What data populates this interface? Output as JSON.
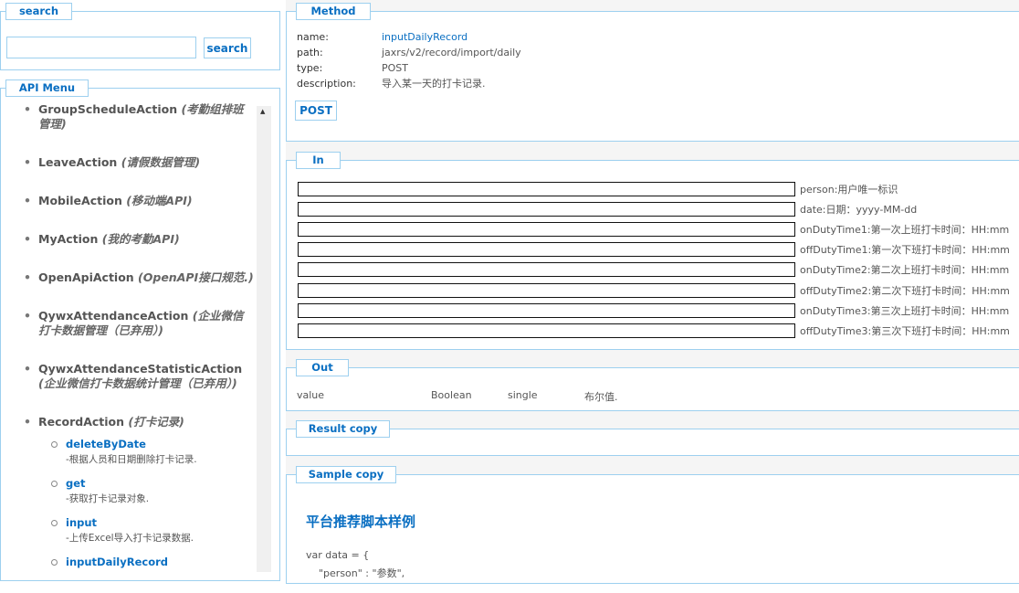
{
  "search": {
    "legend": "search",
    "placeholder": "",
    "button": "search"
  },
  "menu": {
    "legend": "API Menu",
    "items": [
      {
        "name": "GroupScheduleAction",
        "desc": "(考勤组排班管理)"
      },
      {
        "name": "LeaveAction",
        "desc": "(请假数据管理)"
      },
      {
        "name": "MobileAction",
        "desc": "(移动端API)"
      },
      {
        "name": "MyAction",
        "desc": "(我的考勤API)"
      },
      {
        "name": "OpenApiAction",
        "desc": "(OpenAPI接口规范.)"
      },
      {
        "name": "QywxAttendanceAction",
        "desc": "(企业微信打卡数据管理（已弃用）)"
      },
      {
        "name": "QywxAttendanceStatisticAction",
        "desc": "(企业微信打卡数据统计管理（已弃用）)"
      },
      {
        "name": "RecordAction",
        "desc": "(打卡记录)",
        "subs": [
          {
            "name": "deleteByDate",
            "desc": "-根据人员和日期删除打卡记录."
          },
          {
            "name": "get",
            "desc": "-获取打卡记录对象."
          },
          {
            "name": "input",
            "desc": "-上传Excel导入打卡记录数据."
          },
          {
            "name": "inputDailyRecord",
            "desc": ""
          }
        ]
      }
    ]
  },
  "method": {
    "legend": "Method",
    "name_label": "name:",
    "name": "inputDailyRecord",
    "path_label": "path:",
    "path": "jaxrs/v2/record/import/daily",
    "type_label": "type:",
    "type": "POST",
    "desc_label": "description:",
    "description": "导入某一天的打卡记录.",
    "button": "POST"
  },
  "in": {
    "legend": "In",
    "fields": [
      "person:用户唯一标识",
      "date:日期：yyyy-MM-dd",
      "onDutyTime1:第一次上班打卡时间：HH:mm",
      "offDutyTime1:第一次下班打卡时间：HH:mm",
      "onDutyTime2:第二次上班打卡时间：HH:mm",
      "offDutyTime2:第二次下班打卡时间：HH:mm",
      "onDutyTime3:第三次上班打卡时间：HH:mm",
      "offDutyTime3:第三次下班打卡时间：HH:mm"
    ]
  },
  "out": {
    "legend": "Out",
    "name": "value",
    "type": "Boolean",
    "mode": "single",
    "desc": "布尔值."
  },
  "result": {
    "legend": "Result copy"
  },
  "sample": {
    "legend": "Sample copy",
    "title": "平台推荐脚本样例",
    "code1": "var data = {",
    "code2": "    \"person\" : \"参数\","
  }
}
